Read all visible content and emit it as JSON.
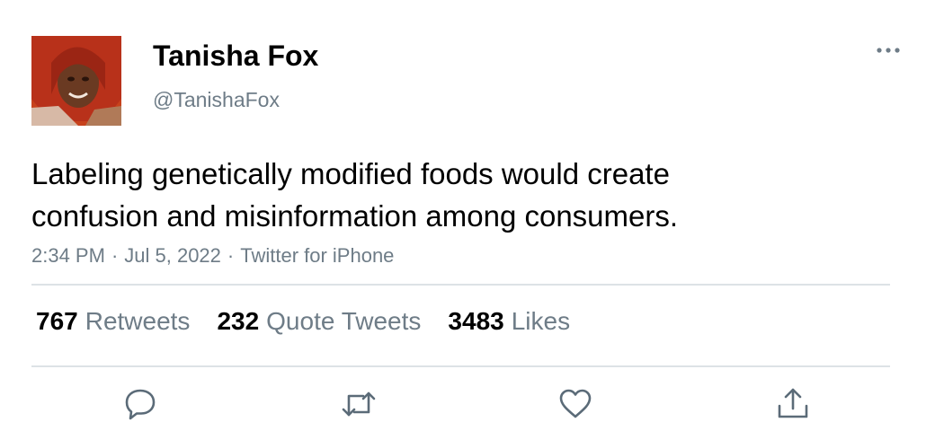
{
  "user": {
    "display_name": "Tanisha Fox",
    "handle": "@TanishaFox"
  },
  "tweet": {
    "text_lines": [
      "Labeling genetically modified foods would create",
      "confusion and misinformation among consumers."
    ],
    "time": "2:34 PM",
    "date": "Jul 5, 2022",
    "source": "Twitter for iPhone",
    "separator": "·"
  },
  "stats": {
    "retweets_count": "767",
    "retweets_label": "Retweets",
    "quotes_count": "232",
    "quotes_label": "Quote Tweets",
    "likes_count": "3483",
    "likes_label": "Likes"
  },
  "icons": {
    "more": "more-horizontal-icon",
    "reply": "reply-icon",
    "retweet": "retweet-icon",
    "like": "heart-icon",
    "share": "share-icon"
  },
  "colors": {
    "text": "#000000",
    "secondary": "#6e7c87",
    "divider": "#dde2e6",
    "icon": "#5b6b78"
  }
}
